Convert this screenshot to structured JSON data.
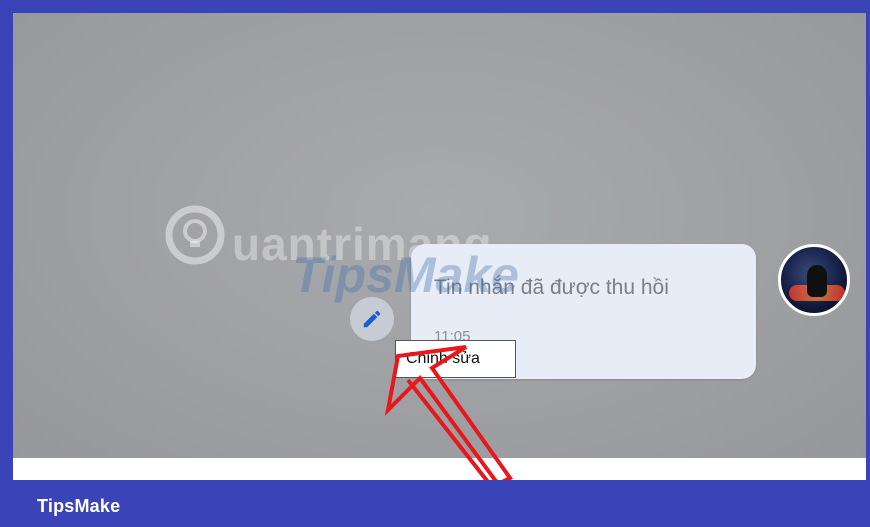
{
  "message": {
    "text": "Tin nhắn đã được thu hồi",
    "time": "11:05"
  },
  "tooltip": {
    "label": "Chỉnh sửa"
  },
  "watermark": {
    "text": "uantrimang",
    "overlay": "TipsMake"
  },
  "footer": {
    "brand": "TipsMake"
  },
  "icons": {
    "edit": "pencil-icon",
    "avatar": "user-avatar"
  },
  "colors": {
    "frame": "#3a43b8",
    "bubble": "#e7ecf7",
    "arrow": "#e8171c"
  }
}
